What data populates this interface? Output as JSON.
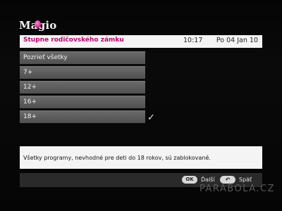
{
  "logo": {
    "text": "Magio",
    "accent_color": "#d0208f"
  },
  "header": {
    "title": "Stupne rodičovského zámku",
    "time": "10:17",
    "date": "Po 04 Jan 10",
    "title_color": "#c0006e"
  },
  "menu": {
    "items": [
      {
        "label": "Pozrieť všetky"
      },
      {
        "label": "7+"
      },
      {
        "label": "12+"
      },
      {
        "label": "16+"
      },
      {
        "label": "18+",
        "checked": true
      }
    ],
    "check_icon": "✓"
  },
  "info": {
    "text": "Všetky programy, nevhodné pre deti do 18 rokov, sú zablokované."
  },
  "footer": {
    "ok_icon": "OK",
    "ok_label": "Ďalší",
    "back_icon": "↶",
    "back_label": "Späť"
  },
  "watermark": "PARABOLA.CZ"
}
